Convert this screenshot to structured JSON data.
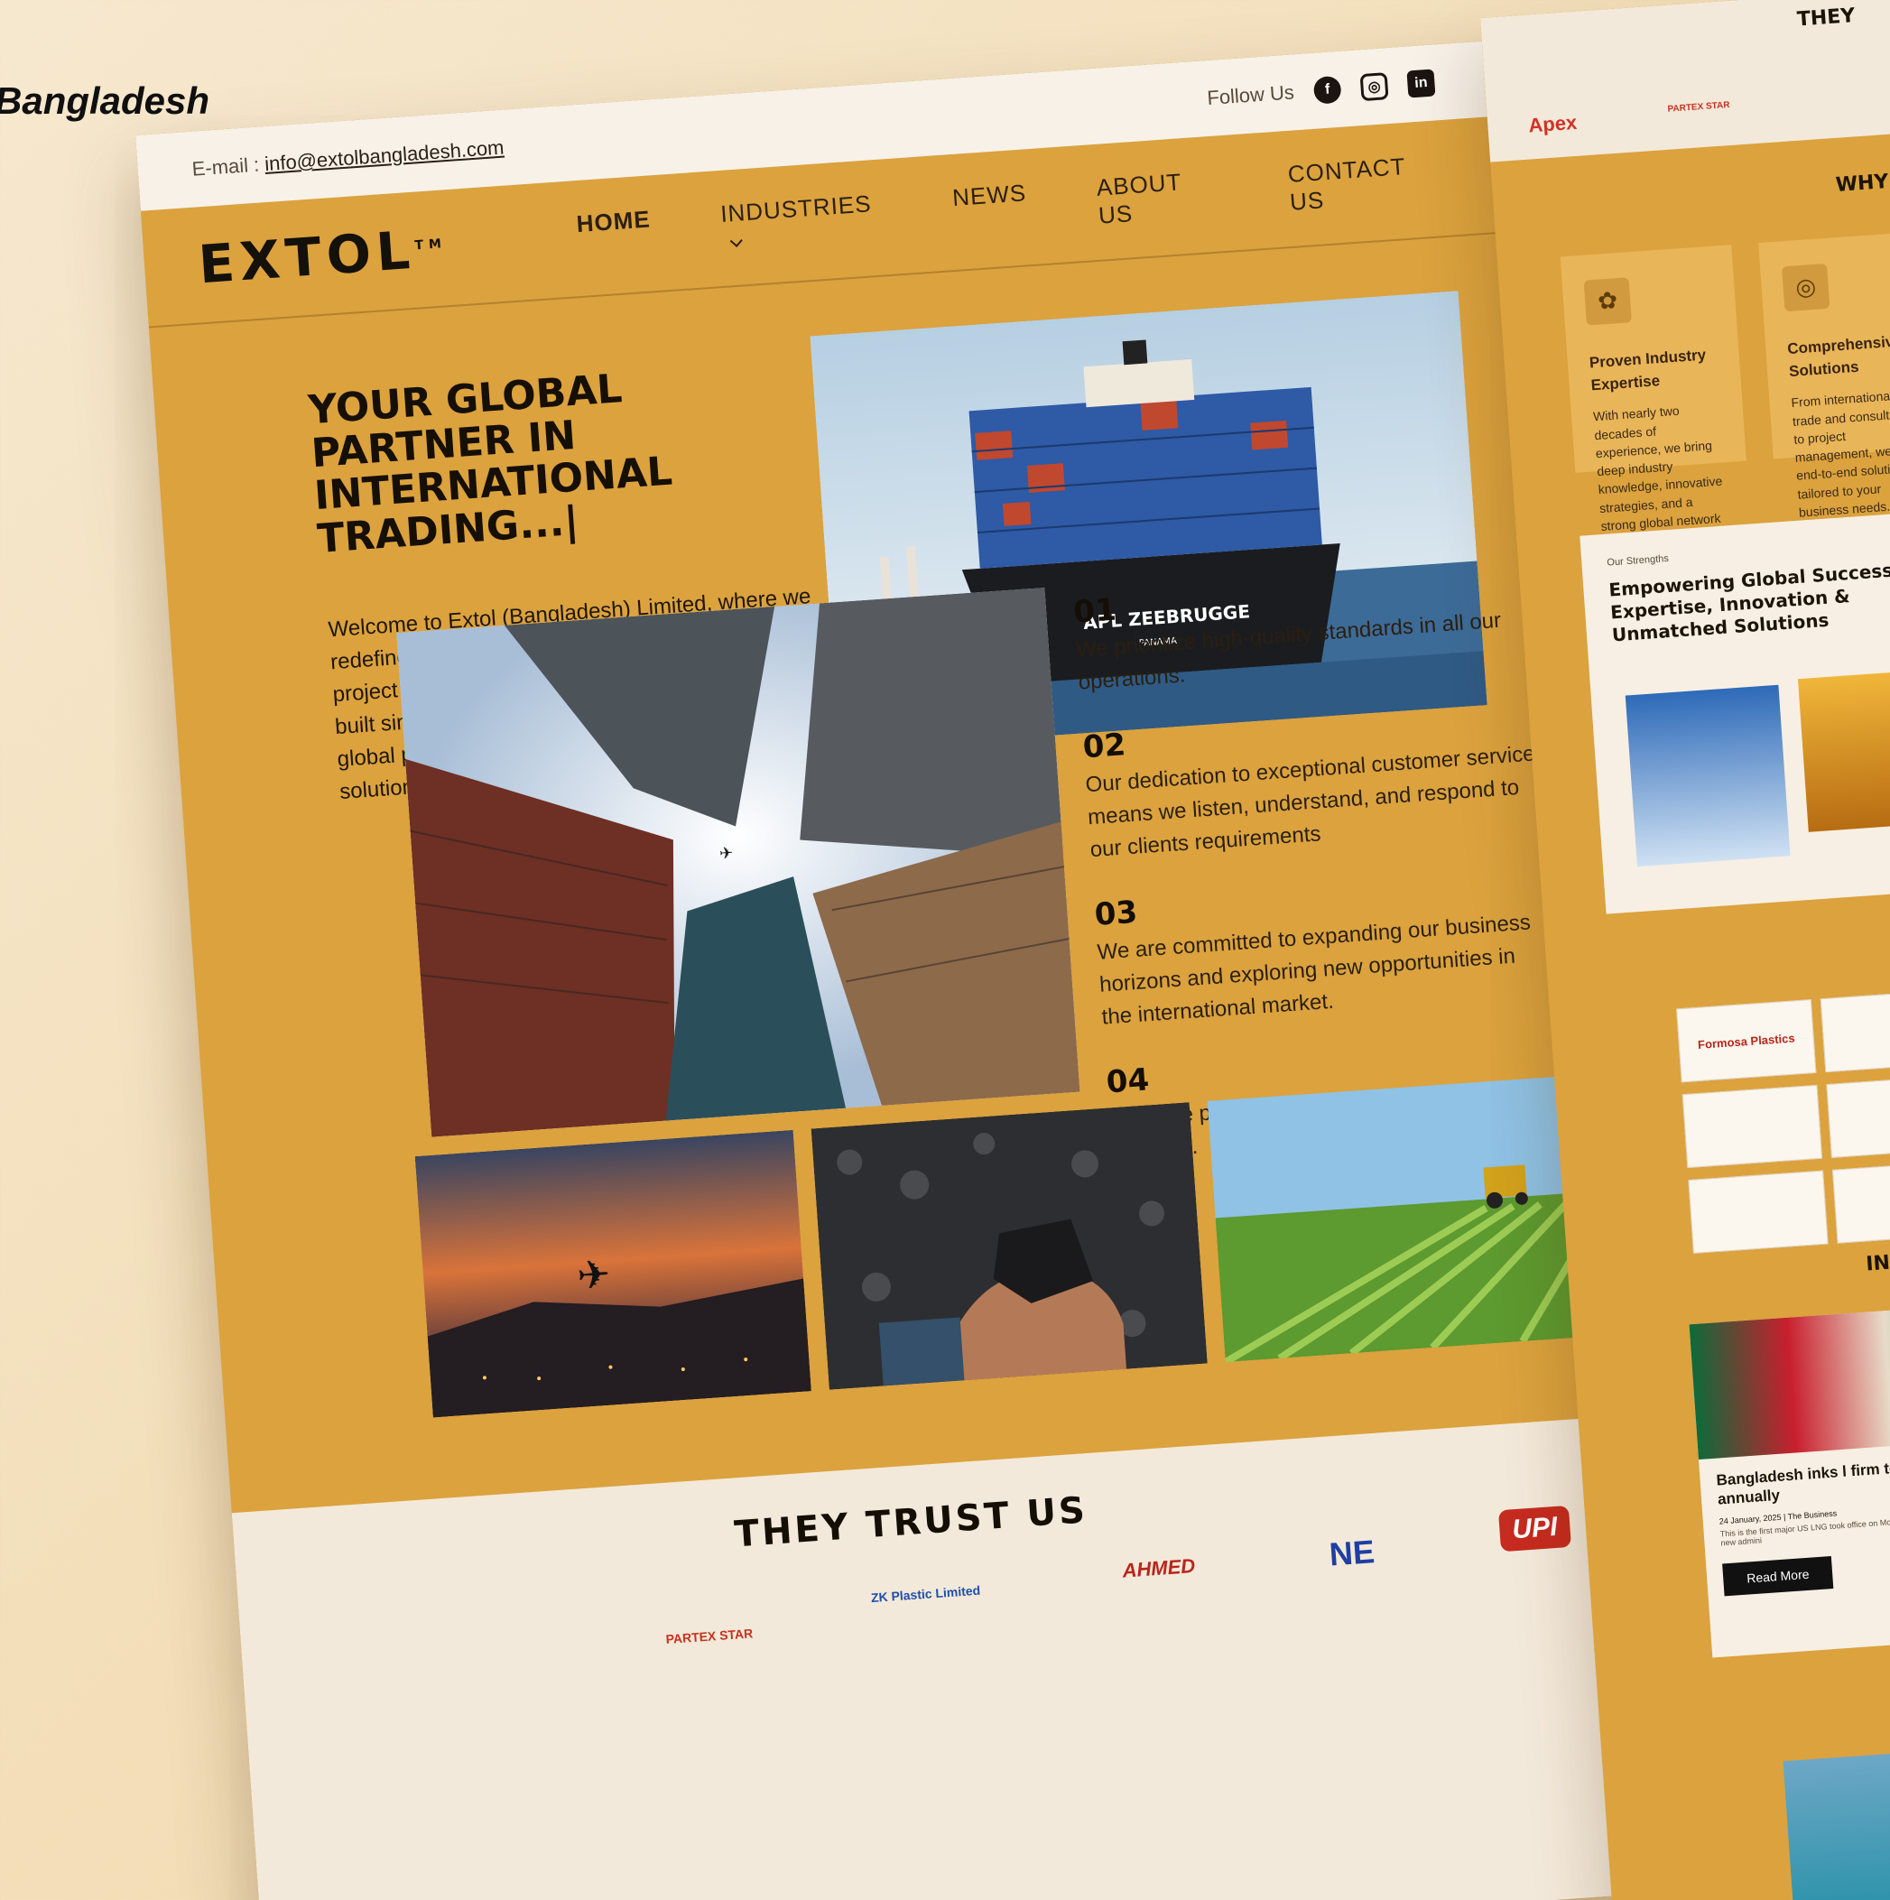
{
  "page_label": "Bangladesh",
  "topbar": {
    "email_label": "E-mail : ",
    "email": "info@extolbangladesh.com",
    "follow": "Follow Us",
    "social": [
      {
        "icon": "facebook-icon",
        "glyph": "f"
      },
      {
        "icon": "instagram-icon",
        "glyph": "◎"
      },
      {
        "icon": "linkedin-icon",
        "glyph": "in"
      }
    ]
  },
  "brand": {
    "logo": "EXTOL",
    "tm": "TM"
  },
  "nav": {
    "home": "HOME",
    "industries": "INDUSTRIES",
    "news": "NEWS",
    "about": "ABOUT US",
    "contact": "CONTACT US"
  },
  "hero": {
    "headline": "YOUR GLOBAL PARTNER IN INTERNATIONAL TRADING...|",
    "intro": "Welcome to Extol (Bangladesh) Limited, where we redefine excellence in international trading and project management. With a strong foundation built since 2005, we are committed to fostering global partnerships and delivering world-class solutions across various sectors.",
    "ship_text": "APL  ZEEBRUGGE",
    "ship_sub": "PANAMA"
  },
  "features": [
    {
      "num": "01",
      "text": "We prioritize high-quality standards in all our operations."
    },
    {
      "num": "02",
      "text": "Our dedication to exceptional customer service means we listen, understand, and respond to our clients requirements"
    },
    {
      "num": "03",
      "text": "We are committed to expanding our business horizons and exploring new opportunities in the international market."
    },
    {
      "num": "04",
      "text": "Our core philosophy emphasizes integrity in all dealings."
    }
  ],
  "trust": {
    "title": "THEY TRUST US",
    "logos": [
      {
        "name": "ahmed",
        "text": "AHMED",
        "color": "#b8261c"
      },
      {
        "name": "ne",
        "text": "NE",
        "color": "#1f3fa0"
      },
      {
        "name": "upi",
        "text": "UPI",
        "color": "#ffffff"
      },
      {
        "name": "zk",
        "text": "ZK Plastic Limited",
        "color": "#1f4fa8"
      },
      {
        "name": "partex",
        "text": "PARTEX STAR",
        "color": "#c8321f"
      }
    ]
  },
  "right": {
    "trust_title": "THEY",
    "apex": "Apex",
    "partex": "PARTEX STAR",
    "why_title": "WHY",
    "cards": [
      {
        "title": "Proven Industry Expertise",
        "text": "With nearly two decades of experience, we bring deep industry knowledge, innovative strategies, and a strong global network to every project."
      },
      {
        "title": "Comprehensive Solutions",
        "text": "From international trade and consultancy to project management, we offer end-to-end solutions tailored to your business needs."
      }
    ],
    "strength_label": "Our Strengths",
    "strength_title": "Empowering Global Success with Expertise, Innovation & Unmatched Solutions",
    "partner_logos": [
      "Formosa Plastics",
      "",
      "",
      "",
      "",
      ""
    ],
    "insights_title": "INS",
    "news_title": "Bangladesh inks l firm to buy up to annually",
    "news_meta": "24 January, 2025  |  The Business",
    "news_text": "This is the first major US LNG took office on Monday, and an confidence in the new admini",
    "read_more": "Read More"
  },
  "colors": {
    "accent": "#dba23e",
    "cream": "#f3e9da",
    "dark": "#140e05"
  }
}
